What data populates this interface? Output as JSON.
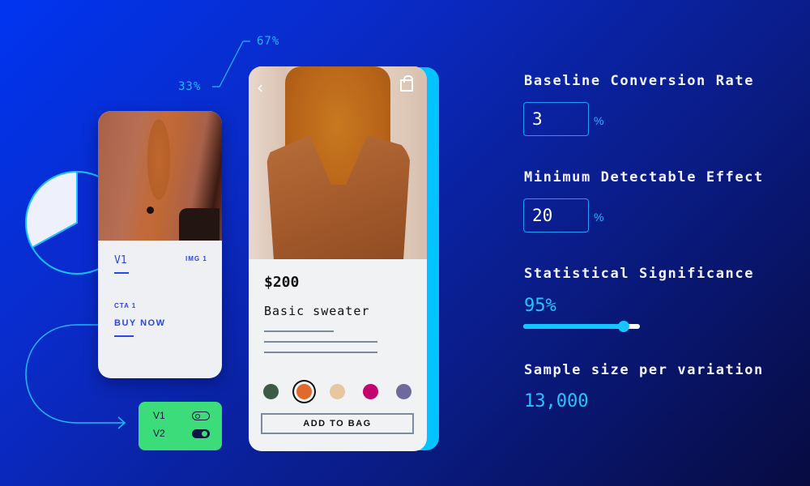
{
  "annotation": {
    "split_a": "33%",
    "split_b": "67%"
  },
  "pie": {
    "variation_a_share": 0.33,
    "variation_b_share": 0.67
  },
  "phone_v1": {
    "variant": "V1",
    "image_tag": "IMG 1",
    "cta_tag": "CTA 1",
    "cta_label": "BUY NOW"
  },
  "toggle_panel": {
    "rows": [
      {
        "label": "V1",
        "state": "off"
      },
      {
        "label": "V2",
        "state": "on"
      }
    ]
  },
  "phone_v2": {
    "back_icon": "chevron-left",
    "bag_icon": "shopping-bag",
    "price": "$200",
    "product_name": "Basic sweater",
    "swatches": [
      {
        "color": "#3d5a47",
        "selected": false
      },
      {
        "color": "#e0692b",
        "selected": true
      },
      {
        "color": "#e8c6a0",
        "selected": false
      },
      {
        "color": "#c4046e",
        "selected": false
      },
      {
        "color": "#6f6a9e",
        "selected": false
      }
    ],
    "add_to_bag_label": "ADD TO BAG"
  },
  "calculator": {
    "baseline_label": "Baseline Conversion Rate",
    "baseline_value": "3",
    "baseline_unit": "%",
    "mde_label": "Minimum Detectable Effect",
    "mde_value": "20",
    "mde_unit": "%",
    "significance_label": "Statistical Significance",
    "significance_value": "95%",
    "significance_slider_fraction": 0.86,
    "sample_label": "Sample size per variation",
    "sample_value": "13,000"
  },
  "colors": {
    "accent_cyan": "#21b9ff",
    "link_blue": "#2a46e8",
    "toggle_green": "#3ddc7a"
  }
}
